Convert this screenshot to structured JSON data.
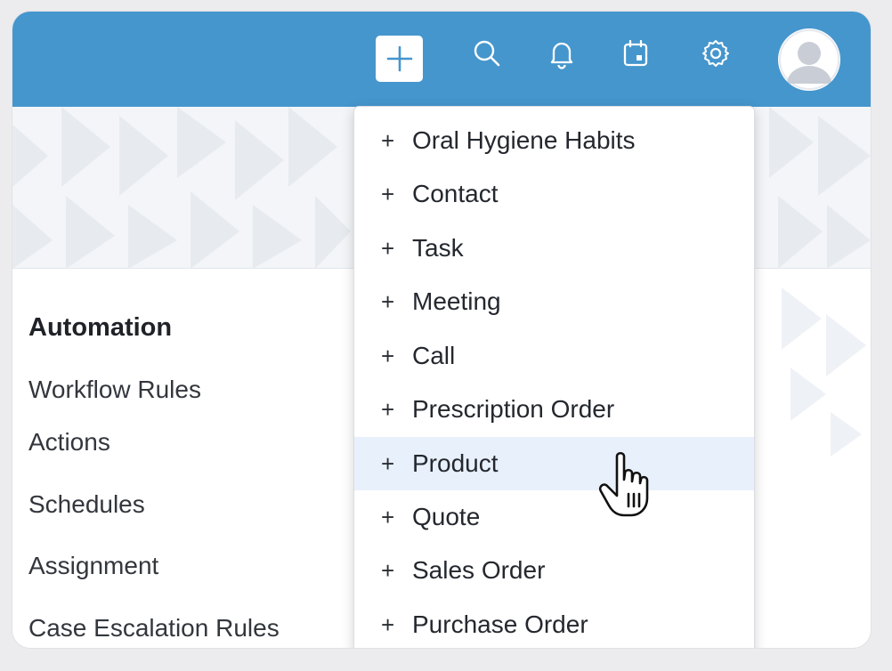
{
  "header": {
    "background_color": "#4596cd",
    "icons": [
      {
        "name": "plus-icon",
        "label": ""
      },
      {
        "name": "search-icon",
        "label": ""
      },
      {
        "name": "bell-icon",
        "label": ""
      },
      {
        "name": "calendar-icon",
        "label": ""
      },
      {
        "name": "gear-icon",
        "label": ""
      },
      {
        "name": "avatar-icon",
        "label": ""
      }
    ]
  },
  "sidebar": {
    "heading": "Automation",
    "items": [
      {
        "label": "Workflow Rules"
      },
      {
        "label": "Actions"
      },
      {
        "label": "Schedules"
      },
      {
        "label": "Assignment"
      },
      {
        "label": "Case Escalation Rules"
      }
    ]
  },
  "create_menu": {
    "prefix": "+",
    "hovered_index": 6,
    "hover_color": "#e8f0fb",
    "items": [
      {
        "label": "Oral Hygiene Habits"
      },
      {
        "label": "Contact"
      },
      {
        "label": "Task"
      },
      {
        "label": "Meeting"
      },
      {
        "label": "Call"
      },
      {
        "label": "Prescription Order"
      },
      {
        "label": "Product"
      },
      {
        "label": "Quote"
      },
      {
        "label": "Sales Order"
      },
      {
        "label": "Purchase Order"
      }
    ]
  },
  "cursor": {
    "icon": "hand-pointer-icon"
  }
}
